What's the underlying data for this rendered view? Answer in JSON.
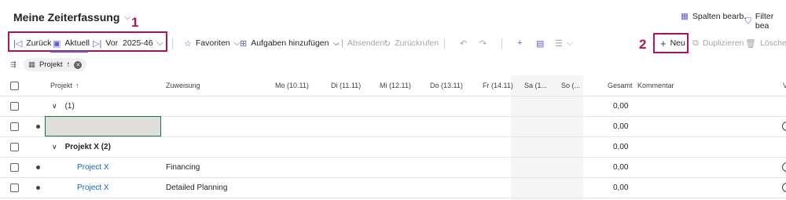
{
  "header": {
    "title": "Meine Zeiterfassung",
    "spalten_label": "Spalten bearb.",
    "filter_label": "Filter bea"
  },
  "toolbar": {
    "back_label": "Zurück",
    "current_label": "Aktuell",
    "next_label": "Vor",
    "week_value": "2025-46",
    "favorites_label": "Favoriten",
    "add_tasks_label": "Aufgaben hinzufügen",
    "send_label": "Absenden",
    "recall_label": "Zurückrufen",
    "new_label": "Neu",
    "duplicate_label": "Duplizieren",
    "delete_label": "Löschen"
  },
  "annotations": {
    "one": "1",
    "two": "2"
  },
  "filter": {
    "chip_label": "Projekt",
    "chip_sort_glyph": "↑",
    "chip_close_glyph": "✕"
  },
  "table": {
    "columns": {
      "project": "Projekt",
      "project_sort": "↑",
      "assignment": "Zuweisung",
      "mo": "Mo (10.11)",
      "di": "Di (11.11)",
      "mi": "Mi (12.11)",
      "do": "Do (13.11)",
      "fr": "Fr (14.11)",
      "sa": "Sa (1...",
      "so": "So (...",
      "total": "Gesamt",
      "comment": "Kommentar",
      "extra": "V"
    },
    "rows": [
      {
        "type": "group",
        "label": "(1)",
        "total": "0,00"
      },
      {
        "type": "new",
        "total": "0,00"
      },
      {
        "type": "group",
        "label": "Projekt X (2)",
        "total": "0,00"
      },
      {
        "type": "item",
        "project": "Project X",
        "assignment": "Financing",
        "total": "0,00"
      },
      {
        "type": "item",
        "project": "Project X",
        "assignment": "Detailed Planning",
        "total": "0,00"
      }
    ]
  },
  "colors": {
    "accent": "#5b5fc7",
    "highlight": "#b4135a",
    "link": "#1565c0"
  }
}
